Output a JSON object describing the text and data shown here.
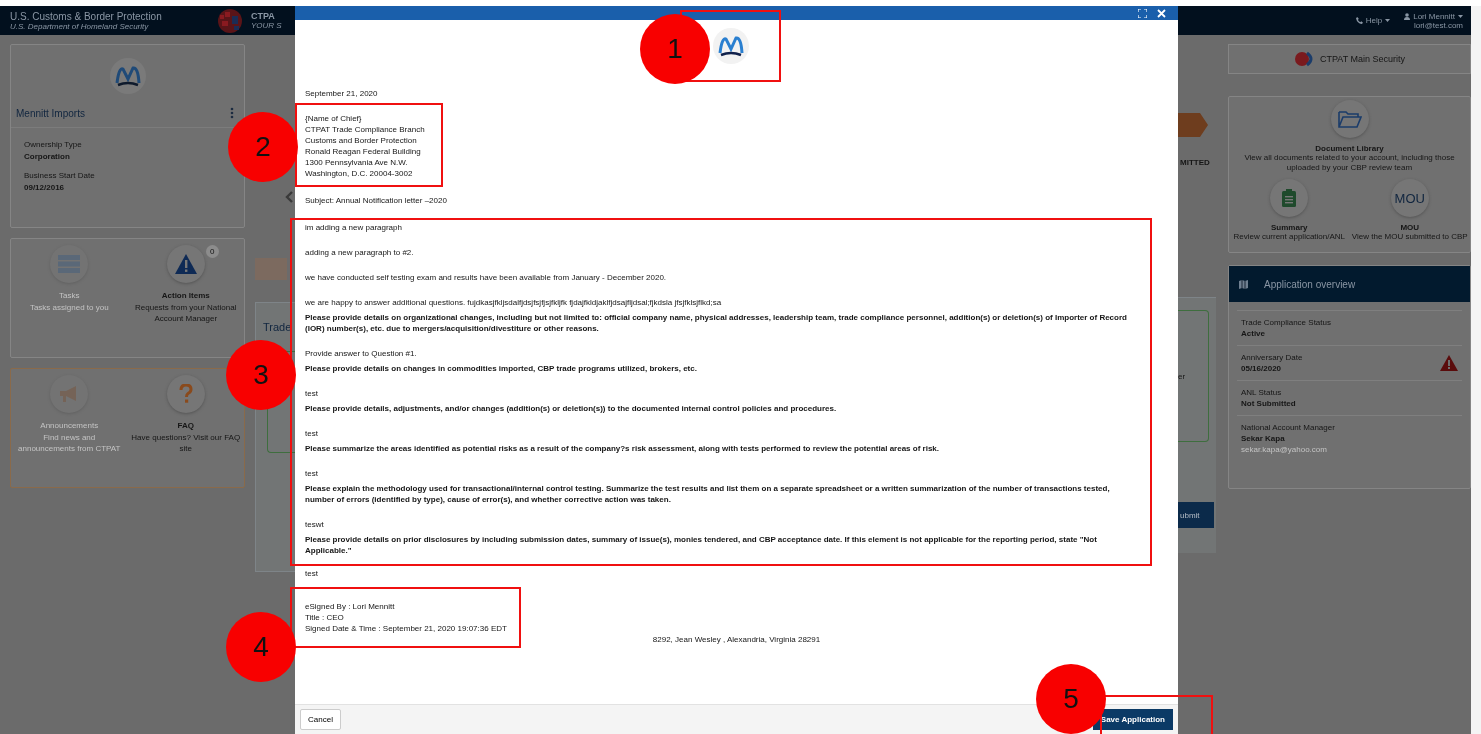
{
  "header": {
    "agency": "U.S. Customs & Border Protection",
    "department": "U.S. Department of Homeland Security",
    "app_title": "CTPA",
    "app_tagline": "YOUR S",
    "help": "Help",
    "user_name": "Lori Mennitt",
    "user_email": "lori@test.com"
  },
  "company_card": {
    "name": "Mennitt Imports",
    "fields": [
      {
        "label": "Ownership Type",
        "value": "Corporation"
      },
      {
        "label": "Business Start Date",
        "value": "09/12/2016"
      }
    ]
  },
  "tile_groups": [
    {
      "kind": "account",
      "tiles": [
        {
          "kind": "tasks",
          "title": "Tasks",
          "description": "Tasks assigned to you",
          "disabled": true
        },
        {
          "kind": "action",
          "title": "Action Items",
          "description": "Requests from your National Account Manager",
          "disabled": false,
          "badge": "0"
        }
      ]
    },
    {
      "kind": "resources",
      "tiles": [
        {
          "kind": "announcements",
          "title": "Announcements",
          "description": "Find news and announcements from CTPAT",
          "disabled": true
        },
        {
          "kind": "faq",
          "title": "FAQ",
          "description": "Have questions? Visit our FAQ site",
          "disabled": false
        }
      ]
    }
  ],
  "background_fragments": {
    "left_card_title": "Trade",
    "right_status": "MITTED",
    "right_card_text": "er",
    "right_button": "ubmit"
  },
  "program_button": "CTPAT Main Security",
  "quick_links": [
    {
      "kind": "folder",
      "title": "Document Library",
      "description": "View all documents related to your account, including those uploaded by your CBP review team"
    },
    {
      "kind": "clipboard",
      "title": "Summary",
      "description": "Review current application/ANL"
    },
    {
      "kind": "mou",
      "icon_text": "MOU",
      "title": "MOU",
      "description": "View the MOU submitted to CBP"
    }
  ],
  "overview": {
    "title": "Application overview",
    "rows": [
      {
        "label": "Trade Compliance Status",
        "value": "Active",
        "warning": false
      },
      {
        "label": "Anniversary Date",
        "value": "05/16/2020",
        "warning": true
      },
      {
        "label": "ANL Status",
        "value": "Not Submitted",
        "warning": false
      },
      {
        "label": "National Account Manager",
        "value": "Sekar Kapa",
        "email": "sekar.kapa@yahoo.com",
        "warning": false
      }
    ]
  },
  "modal": {
    "letter": {
      "date": "September 21, 2020",
      "recipient": [
        "{Name of Chief}",
        "CTPAT Trade Compliance Branch",
        "Customs and Border Protection",
        "Ronald Reagan Federal Building",
        "1300 Pennsylvania Ave N.W.",
        "Washington, D.C. 20004-3002"
      ],
      "subject": "Subject: Annual Notification letter –2020",
      "body": [
        {
          "kind": "answer",
          "text": "im adding a new paragraph"
        },
        {
          "kind": "answer",
          "text": "adding a new paragraph to #2."
        },
        {
          "kind": "answer",
          "text": "we have conducted self testing exam and results have been available from January - December 2020."
        },
        {
          "kind": "answer",
          "text": "we are happy to answer additional questions. fujdkasjfkljsdalfjdsjfsjfjsjfkljfk fjdajfkldjaklfjdsajfljdsal;fjkdsla jfsjfklsjflkd;sa"
        },
        {
          "kind": "question",
          "text": "Please provide details on organizational changes, including but not limited to: official company name, physical addresses, leadership team, trade compliance personnel, addition(s) or deletion(s) of Importer of Record (IOR) number(s), etc. due to mergers/acquisition/divestiture or other reasons."
        },
        {
          "kind": "answer",
          "text": "Provide answer to Question #1."
        },
        {
          "kind": "question",
          "text": "Please provide details on changes in commodities imported, CBP trade programs utilized, brokers, etc."
        },
        {
          "kind": "answer",
          "text": "test"
        },
        {
          "kind": "question",
          "text": "Please provide details, adjustments, and/or changes (addition(s) or deletion(s)) to the documented internal control policies and procedures."
        },
        {
          "kind": "answer",
          "text": "test"
        },
        {
          "kind": "question",
          "text": "Please summarize the areas identified as potential risks as a result of the company?s risk assessment, along with tests performed to review the potential areas of risk."
        },
        {
          "kind": "answer",
          "text": "test"
        },
        {
          "kind": "question",
          "text": "Please explain the methodology used for transactional/internal control testing. Summarize the test results and list them on a separate spreadsheet or a written summarization of the number of transactions tested, number of errors (identified by type), cause of error(s), and whether corrective action was taken."
        },
        {
          "kind": "answer",
          "text": "teswt"
        },
        {
          "kind": "question",
          "text": "Please provide details on prior disclosures by including submission dates, summary of issue(s), monies tendered, and CBP acceptance date. If this element is not applicable for the reporting period, state \"Not Applicable.\""
        },
        {
          "kind": "answer",
          "text": "test"
        }
      ],
      "signature": [
        "eSigned By : Lori Mennitt",
        "Title : CEO",
        "Signed Date & Time : September 21, 2020 19:07:36 EDT"
      ],
      "footer_address": "8292, Jean Wesley , Alexandria, Virginia 28291"
    },
    "cancel_button": "Cancel",
    "save_button": "Save Application"
  },
  "annotations": [
    {
      "number": "1"
    },
    {
      "number": "2"
    },
    {
      "number": "3"
    },
    {
      "number": "4"
    },
    {
      "number": "5"
    }
  ]
}
